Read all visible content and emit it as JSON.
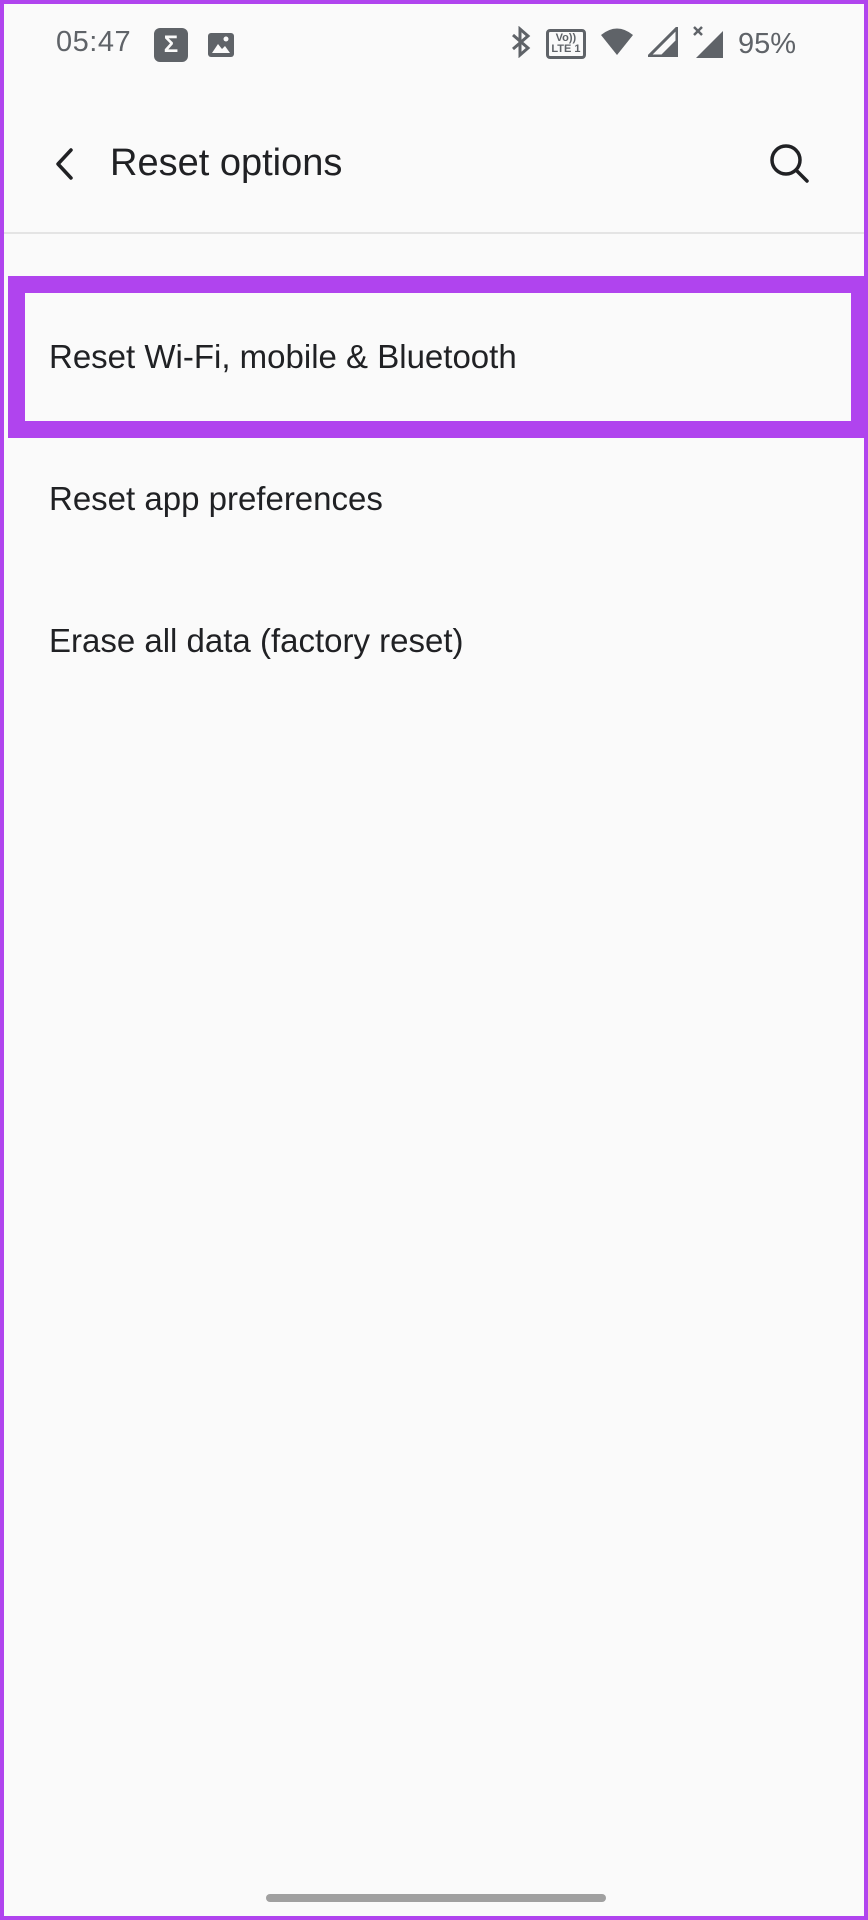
{
  "status_bar": {
    "time": "05:47",
    "battery": "95%",
    "volte_top": "Vo))",
    "volte_bottom": "LTE 1",
    "icons": [
      "sigma-icon",
      "image-icon",
      "bluetooth-icon",
      "volte-icon",
      "wifi-icon",
      "signal-icon",
      "signal-no-service-icon"
    ]
  },
  "app_bar": {
    "title": "Reset options",
    "back_icon": "back-chevron-icon",
    "search_icon": "search-icon"
  },
  "options": [
    {
      "label": "Reset Wi-Fi, mobile & Bluetooth",
      "highlighted": true
    },
    {
      "label": "Reset app preferences",
      "highlighted": false
    },
    {
      "label": "Erase all data (factory reset)",
      "highlighted": false
    }
  ],
  "colors": {
    "highlight": "#b044ee",
    "background": "#fafafa",
    "text": "#202124",
    "status_icons": "#5f6368"
  }
}
